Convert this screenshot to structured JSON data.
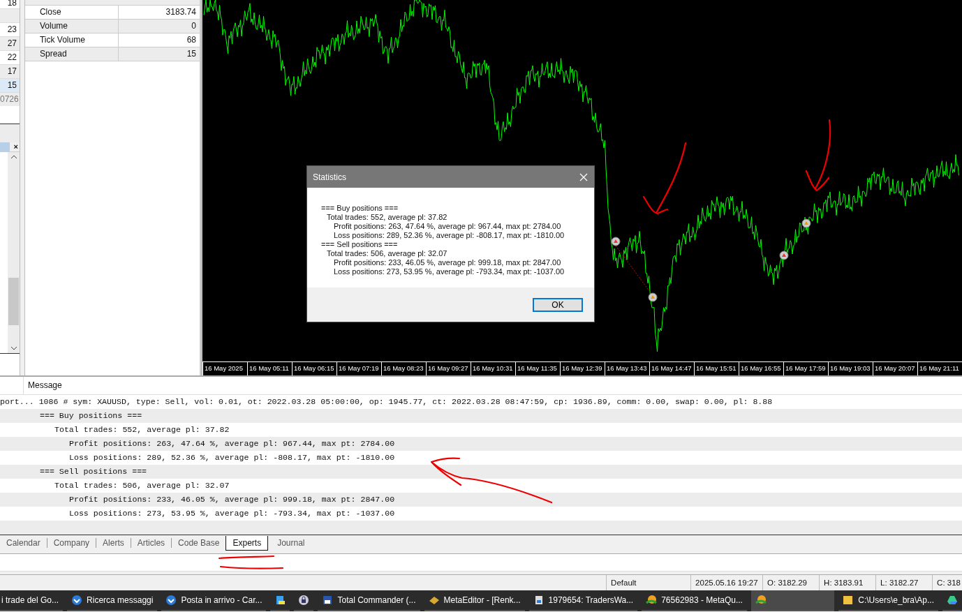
{
  "left_strip": {
    "top_value": "18",
    "close": "×",
    "values": [
      {
        "text": "23",
        "selected": false
      },
      {
        "text": "27",
        "selected": false
      },
      {
        "text": "22",
        "selected": false
      },
      {
        "text": "17",
        "selected": false
      },
      {
        "text": "15",
        "selected": true
      },
      {
        "text": "0726",
        "selected": false
      }
    ]
  },
  "data_window": {
    "rows": [
      {
        "label": "Close",
        "value": "3183.74"
      },
      {
        "label": "Volume",
        "value": "0"
      },
      {
        "label": "Tick Volume",
        "value": "68"
      },
      {
        "label": "Spread",
        "value": "15"
      }
    ]
  },
  "chart": {
    "x_labels": [
      "16 May 2025",
      "16 May 05:11",
      "16 May 06:15",
      "16 May 07:19",
      "16 May 08:23",
      "16 May 09:27",
      "16 May 10:31",
      "16 May 11:35",
      "16 May 12:39",
      "16 May 13:43",
      "16 May 14:47",
      "16 May 15:51",
      "16 May 16:55",
      "16 May 17:59",
      "16 May 19:03",
      "16 May 20:07",
      "16 May 21:11"
    ]
  },
  "dialog": {
    "title": "Statistics",
    "lines": [
      {
        "text": "=== Buy positions ===",
        "children": [
          {
            "text": "Total trades: 552, average pl: 37.82",
            "children": [
              {
                "text": "Profit positions: 263, 47.64 %, average pl: 967.44, max pt: 2784.00"
              },
              {
                "text": "Loss positions: 289, 52.36 %, average pl: -808.17, max pt: -1810.00"
              }
            ]
          }
        ]
      },
      {
        "text": "=== Sell positions ===",
        "children": [
          {
            "text": "Total trades: 506, average pl: 32.07",
            "children": [
              {
                "text": "Profit positions: 233, 46.05 %, average pl: 999.18, max pt: 2847.00"
              },
              {
                "text": "Loss positions: 273, 53.95 %, average pl: -793.34, max pt: -1037.00"
              }
            ]
          }
        ]
      }
    ],
    "button": "OK"
  },
  "log": {
    "header": "Message",
    "rows": [
      {
        "text": "port... 1086 # sym: XAUUSD, type: Sell, vol: 0.01, ot: 2022.03.28 05:00:00, op: 1945.77, ct: 2022.03.28 08:47:59, cp: 1936.89, comm: 0.00, swap: 0.00, pl: 8.88"
      },
      {
        "text": "=== Buy positions ===",
        "children": [
          {
            "text": "Total trades: 552, average pl: 37.82",
            "children": [
              {
                "text": "Profit positions: 263, 47.64 %, average pl: 967.44, max pt: 2784.00"
              },
              {
                "text": "Loss positions: 289, 52.36 %, average pl: -808.17, max pt: -1810.00"
              }
            ]
          }
        ]
      },
      {
        "text": "=== Sell positions ===",
        "children": [
          {
            "text": "Total trades: 506, average pl: 32.07",
            "children": [
              {
                "text": "Profit positions: 233, 46.05 %, average pl: 999.18, max pt: 2847.00"
              },
              {
                "text": "Loss positions: 273, 53.95 %, average pl: -793.34, max pt: -1037.00"
              }
            ]
          }
        ]
      }
    ]
  },
  "tabs": [
    {
      "label": "Calendar",
      "selected": false
    },
    {
      "label": "Company",
      "selected": false
    },
    {
      "label": "Alerts",
      "selected": false
    },
    {
      "label": "Articles",
      "selected": false
    },
    {
      "label": "Code Base",
      "selected": false
    },
    {
      "label": "Experts",
      "selected": true
    },
    {
      "label": "Journal",
      "selected": false
    }
  ],
  "status_bar": [
    "Default",
    "2025.05.16 19:27",
    "O: 3182.29",
    "H: 3183.91",
    "L: 3182.27",
    "C: 318"
  ],
  "taskbar": [
    {
      "label": "i trade del Go...",
      "kind": "none",
      "active": false
    },
    {
      "label": "Ricerca messaggi",
      "kind": "mail",
      "active": false
    },
    {
      "label": "Posta in arrivo - Car...",
      "kind": "mail",
      "active": false
    },
    {
      "kind": "note",
      "active": false
    },
    {
      "kind": "lock",
      "active": false
    },
    {
      "label": "Total Commander (...",
      "kind": "disk",
      "active": false
    },
    {
      "label": "MetaEditor - [Renk...",
      "kind": "editor",
      "active": false
    },
    {
      "label": "1979654: TradersWa...",
      "kind": "report",
      "active": false
    },
    {
      "label": "76562983 - MetaQu...",
      "kind": "terminal",
      "active": false
    },
    {
      "kind": "terminal",
      "active": true
    },
    {
      "label": "C:\\Users\\e_bra\\Ap...",
      "kind": "folder",
      "active": false
    },
    {
      "kind": "drive",
      "active": false
    }
  ]
}
